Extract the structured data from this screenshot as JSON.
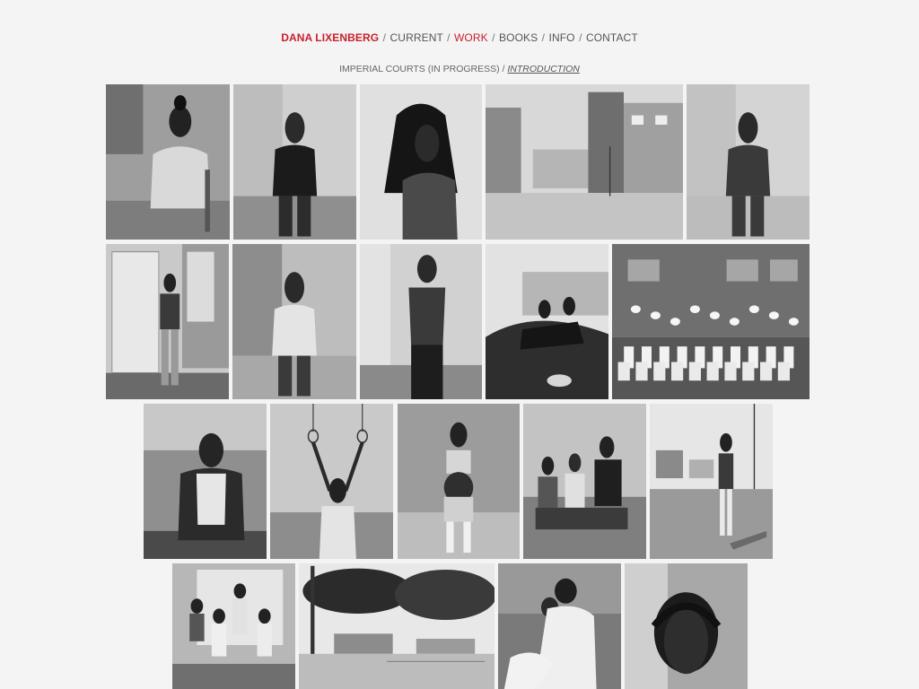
{
  "nav": {
    "brand": "DANA LIXENBERG",
    "items": [
      {
        "label": "CURRENT",
        "active": false
      },
      {
        "label": "WORK",
        "active": true
      },
      {
        "label": "BOOKS",
        "active": false
      },
      {
        "label": "INFO",
        "active": false
      },
      {
        "label": "CONTACT",
        "active": false
      }
    ],
    "separator": "/"
  },
  "subnav": {
    "project": "IMPERIAL COURTS (IN PROGRESS)",
    "separator": "/",
    "link": "INTRODUCTION"
  },
  "colors": {
    "accent": "#c8202f",
    "text": "#555555",
    "background": "#f4f4f4"
  },
  "photos": [
    {
      "name": "photo-woman-seated-chair",
      "scene": "portrait-seated"
    },
    {
      "name": "photo-man-standing-dark-shirt",
      "scene": "portrait-standing-dark"
    },
    {
      "name": "photo-woman-long-braids",
      "scene": "portrait-braids"
    },
    {
      "name": "photo-housing-courtyard",
      "scene": "buildings"
    },
    {
      "name": "photo-girl-track-jacket",
      "scene": "portrait-standing"
    },
    {
      "name": "photo-woman-at-doorway",
      "scene": "doorway"
    },
    {
      "name": "photo-girl-with-braids",
      "scene": "portrait-child"
    },
    {
      "name": "photo-shirtless-young-man",
      "scene": "portrait-shirtless"
    },
    {
      "name": "photo-two-girls-on-car",
      "scene": "car"
    },
    {
      "name": "photo-party-tables-balloons",
      "scene": "party"
    },
    {
      "name": "photo-woman-on-phone",
      "scene": "portrait-phone"
    },
    {
      "name": "photo-woman-on-rings",
      "scene": "portrait-rings"
    },
    {
      "name": "photo-pregnant-woman",
      "scene": "portrait-pregnant"
    },
    {
      "name": "photo-three-boys-seated",
      "scene": "group-seated"
    },
    {
      "name": "photo-girl-in-street",
      "scene": "street"
    },
    {
      "name": "photo-group-of-men",
      "scene": "group-standing"
    },
    {
      "name": "photo-trees-and-court",
      "scene": "trees"
    },
    {
      "name": "photo-mother-and-child",
      "scene": "mother-child"
    },
    {
      "name": "photo-young-woman-closeup",
      "scene": "closeup"
    }
  ]
}
